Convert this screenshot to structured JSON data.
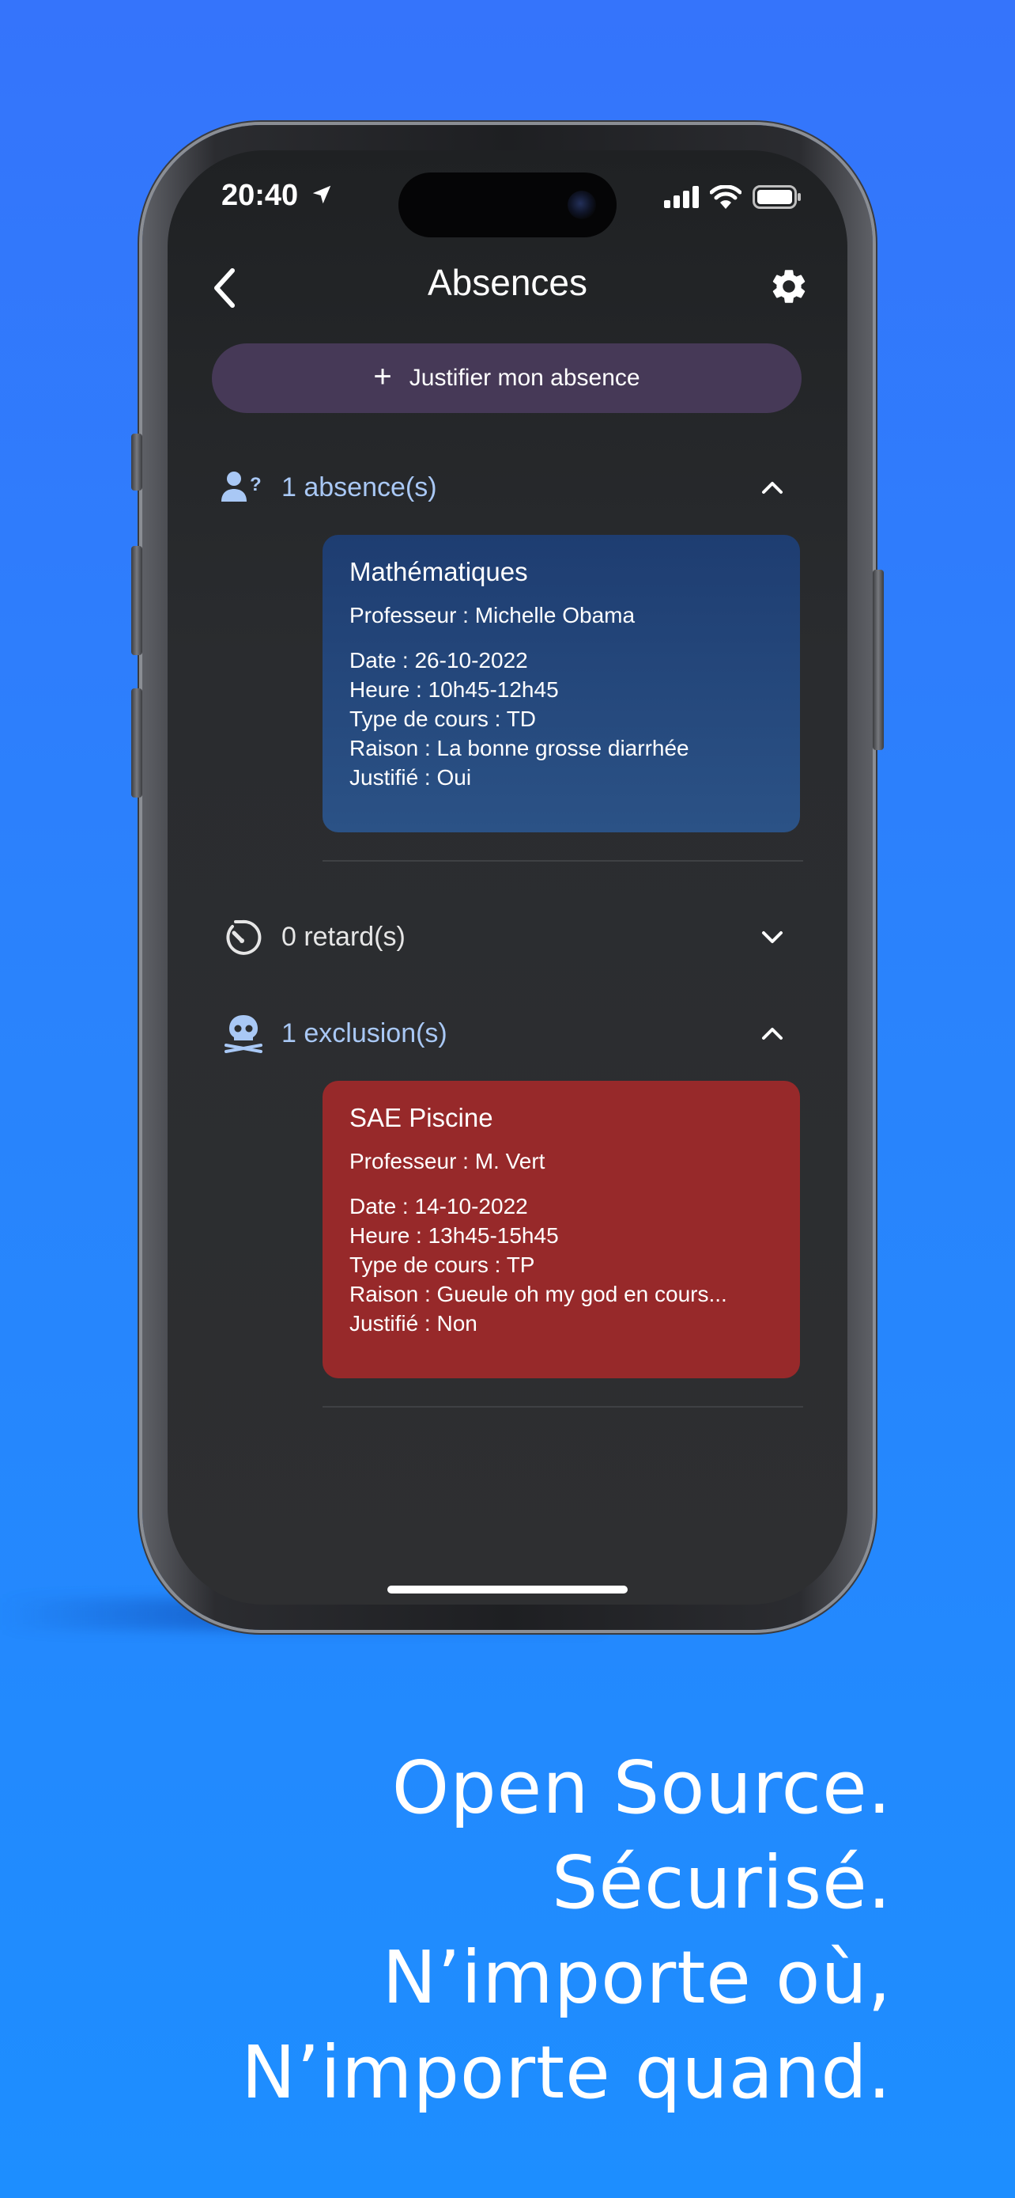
{
  "status_bar": {
    "time": "20:40"
  },
  "nav": {
    "title": "Absences"
  },
  "justify_button": {
    "label": "Justifier mon absence"
  },
  "sections": {
    "absences": {
      "header": "1 absence(s)",
      "card": {
        "subject": "Mathématiques",
        "professor": "Professeur : Michelle Obama",
        "date": "Date : 26-10-2022",
        "hour": "Heure : 10h45-12h45",
        "course_type": "Type de cours : TD",
        "reason": "Raison : La bonne grosse diarrhée",
        "justified": "Justifié : Oui"
      }
    },
    "delays": {
      "header": "0 retard(s)"
    },
    "exclusions": {
      "header": "1 exclusion(s)",
      "card": {
        "subject": "SAE Piscine",
        "professor": "Professeur : M. Vert",
        "date": "Date : 14-10-2022",
        "hour": "Heure : 13h45-15h45",
        "course_type": "Type de cours : TP",
        "reason": "Raison : Gueule oh my god en cours...",
        "justified": "Justifié : Non"
      }
    }
  },
  "colors": {
    "background": "#2a83fc",
    "accent_header": "#a9c8f5",
    "absence_card": "#244a7d",
    "exclusion_card": "#97292a",
    "justify_button": "#463957"
  },
  "tagline": {
    "line1": "Open Source.",
    "line2": "Sécurisé.",
    "line3": "N’importe où,",
    "line4": "N’importe quand."
  },
  "icons": {
    "navigation": "location-arrow-icon",
    "signal": "cellular-signal-icon",
    "wifi": "wifi-icon",
    "battery": "battery-icon",
    "back": "chevron-left-icon",
    "settings": "gear-icon",
    "add": "plus-icon",
    "absence": "person-question-icon",
    "delay": "timer-icon",
    "exclusion": "skull-icon"
  }
}
